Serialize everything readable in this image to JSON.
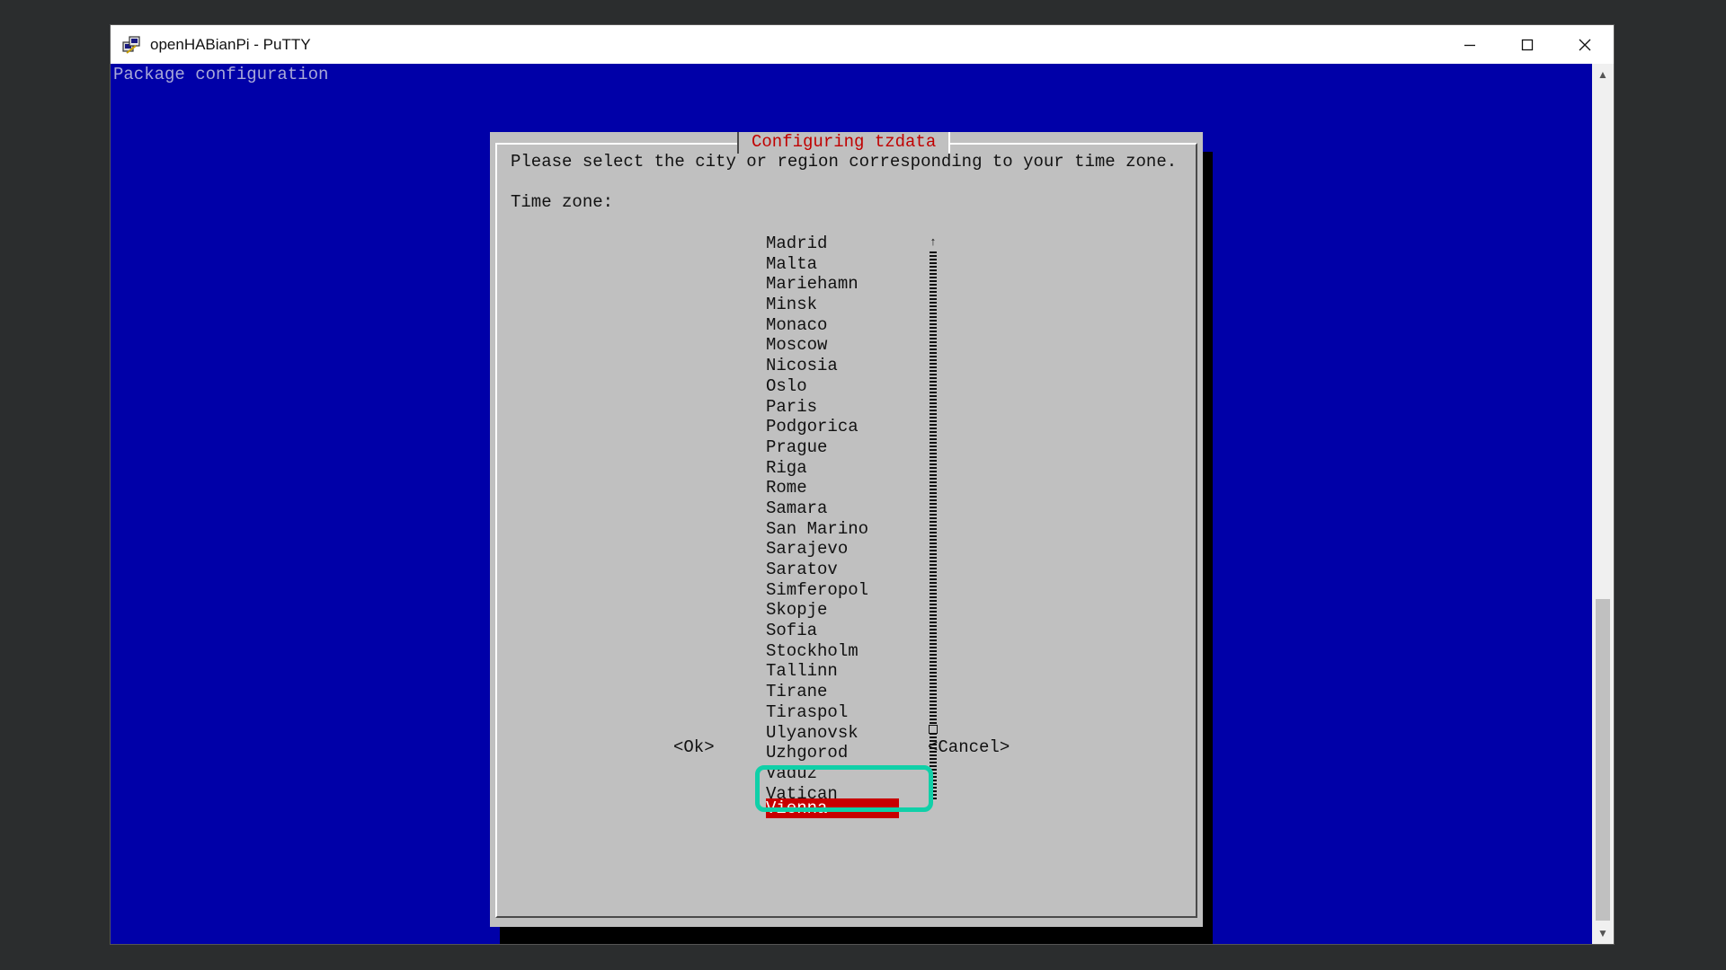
{
  "window": {
    "title": "openHABianPi - PuTTY",
    "icon": "putty-icon",
    "controls": {
      "minimize": "minimize-icon",
      "maximize": "maximize-icon",
      "close": "close-icon"
    }
  },
  "terminal": {
    "header": "Package configuration",
    "dialog": {
      "title": "Configuring tzdata",
      "prompt": "Please select the city or region corresponding to your time zone.",
      "field_label": "Time zone:",
      "options": [
        "Madrid",
        "Malta",
        "Mariehamn",
        "Minsk",
        "Monaco",
        "Moscow",
        "Nicosia",
        "Oslo",
        "Paris",
        "Podgorica",
        "Prague",
        "Riga",
        "Rome",
        "Samara",
        "San Marino",
        "Sarajevo",
        "Saratov",
        "Simferopol",
        "Skopje",
        "Sofia",
        "Stockholm",
        "Tallinn",
        "Tirane",
        "Tiraspol",
        "Ulyanovsk",
        "Uzhgorod",
        "Vaduz",
        "Vatican",
        "Vienna"
      ],
      "selected": "Vienna",
      "ok_label": "<Ok>",
      "cancel_label": "<Cancel>"
    }
  },
  "colors": {
    "terminal_bg": "#0000a8",
    "dialog_bg": "#c0c0c0",
    "title_text": "#c00000",
    "selection_bg": "#c80000",
    "highlight_outline": "#10d0a8"
  }
}
